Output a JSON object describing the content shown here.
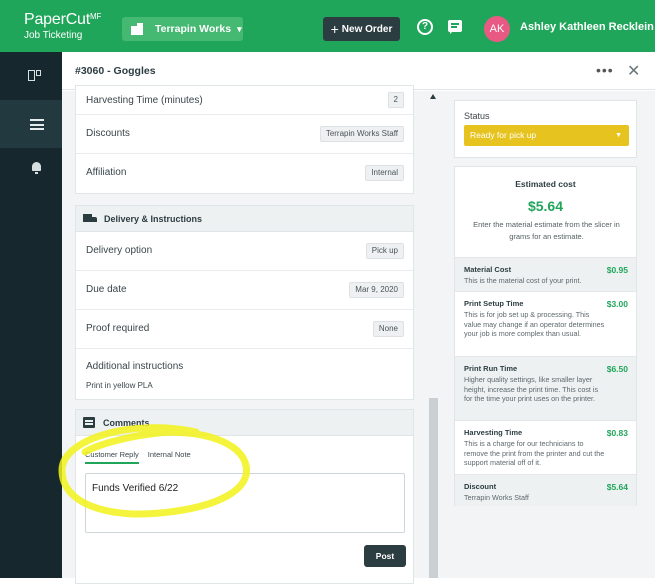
{
  "app": {
    "brand": "PaperCut",
    "brand_suffix": "MF",
    "product": "Job Ticketing"
  },
  "topbar": {
    "org_name": "Terrapin Works",
    "new_order_label": "New Order",
    "user_initials": "AK",
    "user_name": "Ashley Kathleen Recklein",
    "colors": {
      "bar": "#20a65a",
      "avatar": "#e85a84",
      "button": "#2c3d42"
    }
  },
  "header": {
    "order_title": "#3060  -  Goggles"
  },
  "details": [
    {
      "label": "Harvesting Time (minutes)",
      "value": "2"
    },
    {
      "label": "Discounts",
      "value": "Terrapin Works Staff"
    },
    {
      "label": "Affiliation",
      "value": "Internal"
    }
  ],
  "delivery": {
    "heading": "Delivery & Instructions",
    "rows": [
      {
        "label": "Delivery option",
        "value": "Pick up"
      },
      {
        "label": "Due date",
        "value": "Mar 9, 2020"
      },
      {
        "label": "Proof required",
        "value": "None"
      }
    ],
    "instructions_label": "Additional instructions",
    "instructions_value": "Print in yellow PLA"
  },
  "comments": {
    "heading": "Comments",
    "tabs": [
      "Customer Reply",
      "Internal Note"
    ],
    "active_tab": "Customer Reply",
    "text": "Funds Verified 6/22",
    "post_label": "Post"
  },
  "status": {
    "label": "Status",
    "value": "Ready for pick up",
    "color": "#e6c31e"
  },
  "cost": {
    "title": "Estimated cost",
    "total": "$5.64",
    "help": "Enter the material estimate from the slicer in grams for an estimate.",
    "items": [
      {
        "name": "Material Cost",
        "price": "$0.95",
        "desc": "This is the material cost of your print."
      },
      {
        "name": "Print Setup Time",
        "price": "$3.00",
        "desc": "This is for job set up & processing. This value may change if an operator determines your job is more complex than usual."
      },
      {
        "name": "Print Run Time",
        "price": "$6.50",
        "desc": "Higher quality settings, like smaller layer height, increase the print time. This cost is for the time your print uses on the printer."
      },
      {
        "name": "Harvesting Time",
        "price": "$0.83",
        "desc": "This is a charge for our technicians to remove the print from the printer and cut the support material off of it."
      },
      {
        "name": "Discount",
        "price": "$5.64",
        "desc": "Terrapin Works Staff"
      }
    ]
  },
  "annotation": {
    "color": "#f2f21a",
    "shape": "hand-drawn-ellipse"
  }
}
